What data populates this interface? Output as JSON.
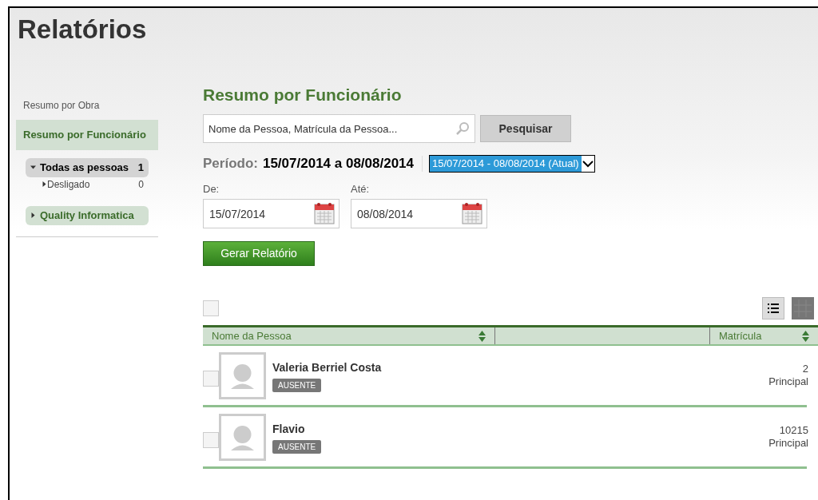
{
  "title": "Relatórios",
  "sidebar": {
    "items": [
      {
        "label": "Resumo por Obra",
        "selected": false
      },
      {
        "label": "Resumo por Funcionário",
        "selected": true
      }
    ],
    "groups": [
      {
        "label": "Todas as pessoas",
        "count": "1",
        "expanded": true,
        "children": [
          {
            "label": "Desligado",
            "count": "0",
            "expanded": false
          }
        ]
      },
      {
        "label": "Quality Informatica",
        "expanded": false
      }
    ]
  },
  "main": {
    "heading": "Resumo por Funcionário",
    "search": {
      "placeholder": "Nome da Pessoa, Matrícula da Pessoa...",
      "button": "Pesquisar"
    },
    "period": {
      "label": "Período:",
      "value": "15/07/2014 a 08/08/2014",
      "select": "15/07/2014 - 08/08/2014 (Atual)"
    },
    "from": {
      "label": "De:",
      "value": "15/07/2014"
    },
    "to": {
      "label": "Até:",
      "value": "08/08/2014"
    },
    "generate_button": "Gerar Relatório",
    "table": {
      "select_all": false,
      "columns": [
        "Nome da Pessoa",
        "",
        "Matrícula"
      ],
      "rows": [
        {
          "name": "Valeria Berriel Costa",
          "status": "AUSENTE",
          "number": "2",
          "type": "Principal",
          "checked": false
        },
        {
          "name": "Flavio",
          "status": "AUSENTE",
          "number": "10215",
          "type": "Principal",
          "checked": false
        }
      ]
    }
  }
}
